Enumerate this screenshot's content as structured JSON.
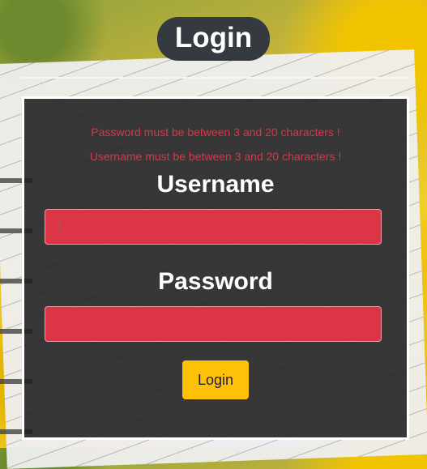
{
  "page": {
    "title": "Login"
  },
  "form": {
    "errors": [
      "Password must be between 3 and 20 characters !",
      "Username must be between 3 and 20 characters !"
    ],
    "username_label": "Username",
    "username_value": "1",
    "password_label": "Password",
    "password_value": "",
    "submit_label": "Login"
  },
  "colors": {
    "error_text": "#dc3545",
    "field_background": "#dc3545",
    "button_background": "#ffc107",
    "panel_background": "#1e1e20",
    "title_background": "#343a40"
  }
}
